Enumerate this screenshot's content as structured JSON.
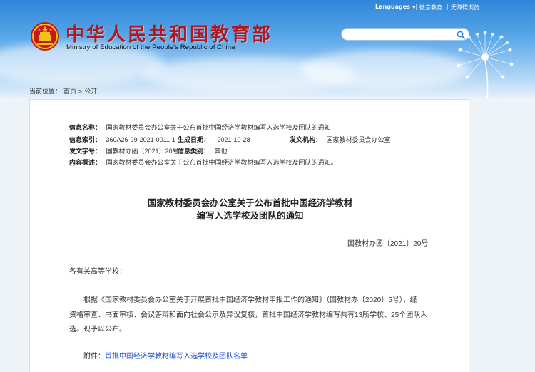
{
  "header": {
    "logo_cn": "中华人民共和国教育部",
    "logo_en": "Ministry of Education of the People's Republic of China",
    "top_links": [
      "Languages",
      "微言教育",
      "无障碍浏览"
    ],
    "search": {
      "placeholder": ""
    }
  },
  "breadcrumb": {
    "prefix": "当前位置：",
    "items": [
      "首页",
      "公开"
    ],
    "separator": ">"
  },
  "info": {
    "name_label": "信息名称：",
    "name_value": "国家教材委员会办公室关于公布首批中国经济学教材编写入选学校及团队的通知",
    "index_label": "信息索引：",
    "index_value": "360A26-99-2021-0011-1",
    "date_label": "生成日期：",
    "date_value": "2021-10-28",
    "org_label": "发文机构：",
    "org_value": "国家教材委员会办公室",
    "docno_label": "发文字号：",
    "docno_value": "国教材办函〔2021〕20号",
    "type_label": "信息类别：",
    "type_value": "其他",
    "summary_label": "内容概述：",
    "summary_value": "国家教材委员会办公室关于公布首批中国经济学教材编写入选学校及团队的通知。"
  },
  "doc": {
    "title_line1": "国家教材委员会办公室关于公布首批中国经济学教材",
    "title_line2": "编写入选学校及团队的通知",
    "number": "国教材办函〔2021〕20号",
    "salutation": "各有关高等学校：",
    "para1_line1": "根据《国家教材委员会办公室关于开展首批中国经济学教材申报工作的通知》（国教材办〔2020〕5号），经",
    "para1_line2": "资格审查、书面审核、会议答辩和面向社会公示及异议复核，首批中国经济学教材编写共有13所学校、25个团队入",
    "para1_line3": "选。现予以公布。",
    "attachment_label": "附件：",
    "attachment_link": "首批中国经济学教材编写入选学校及团队名单"
  },
  "colors": {
    "brand_red": "#b0181d",
    "header_blue": "#2f86d8",
    "link_blue": "#1e4fd0"
  }
}
